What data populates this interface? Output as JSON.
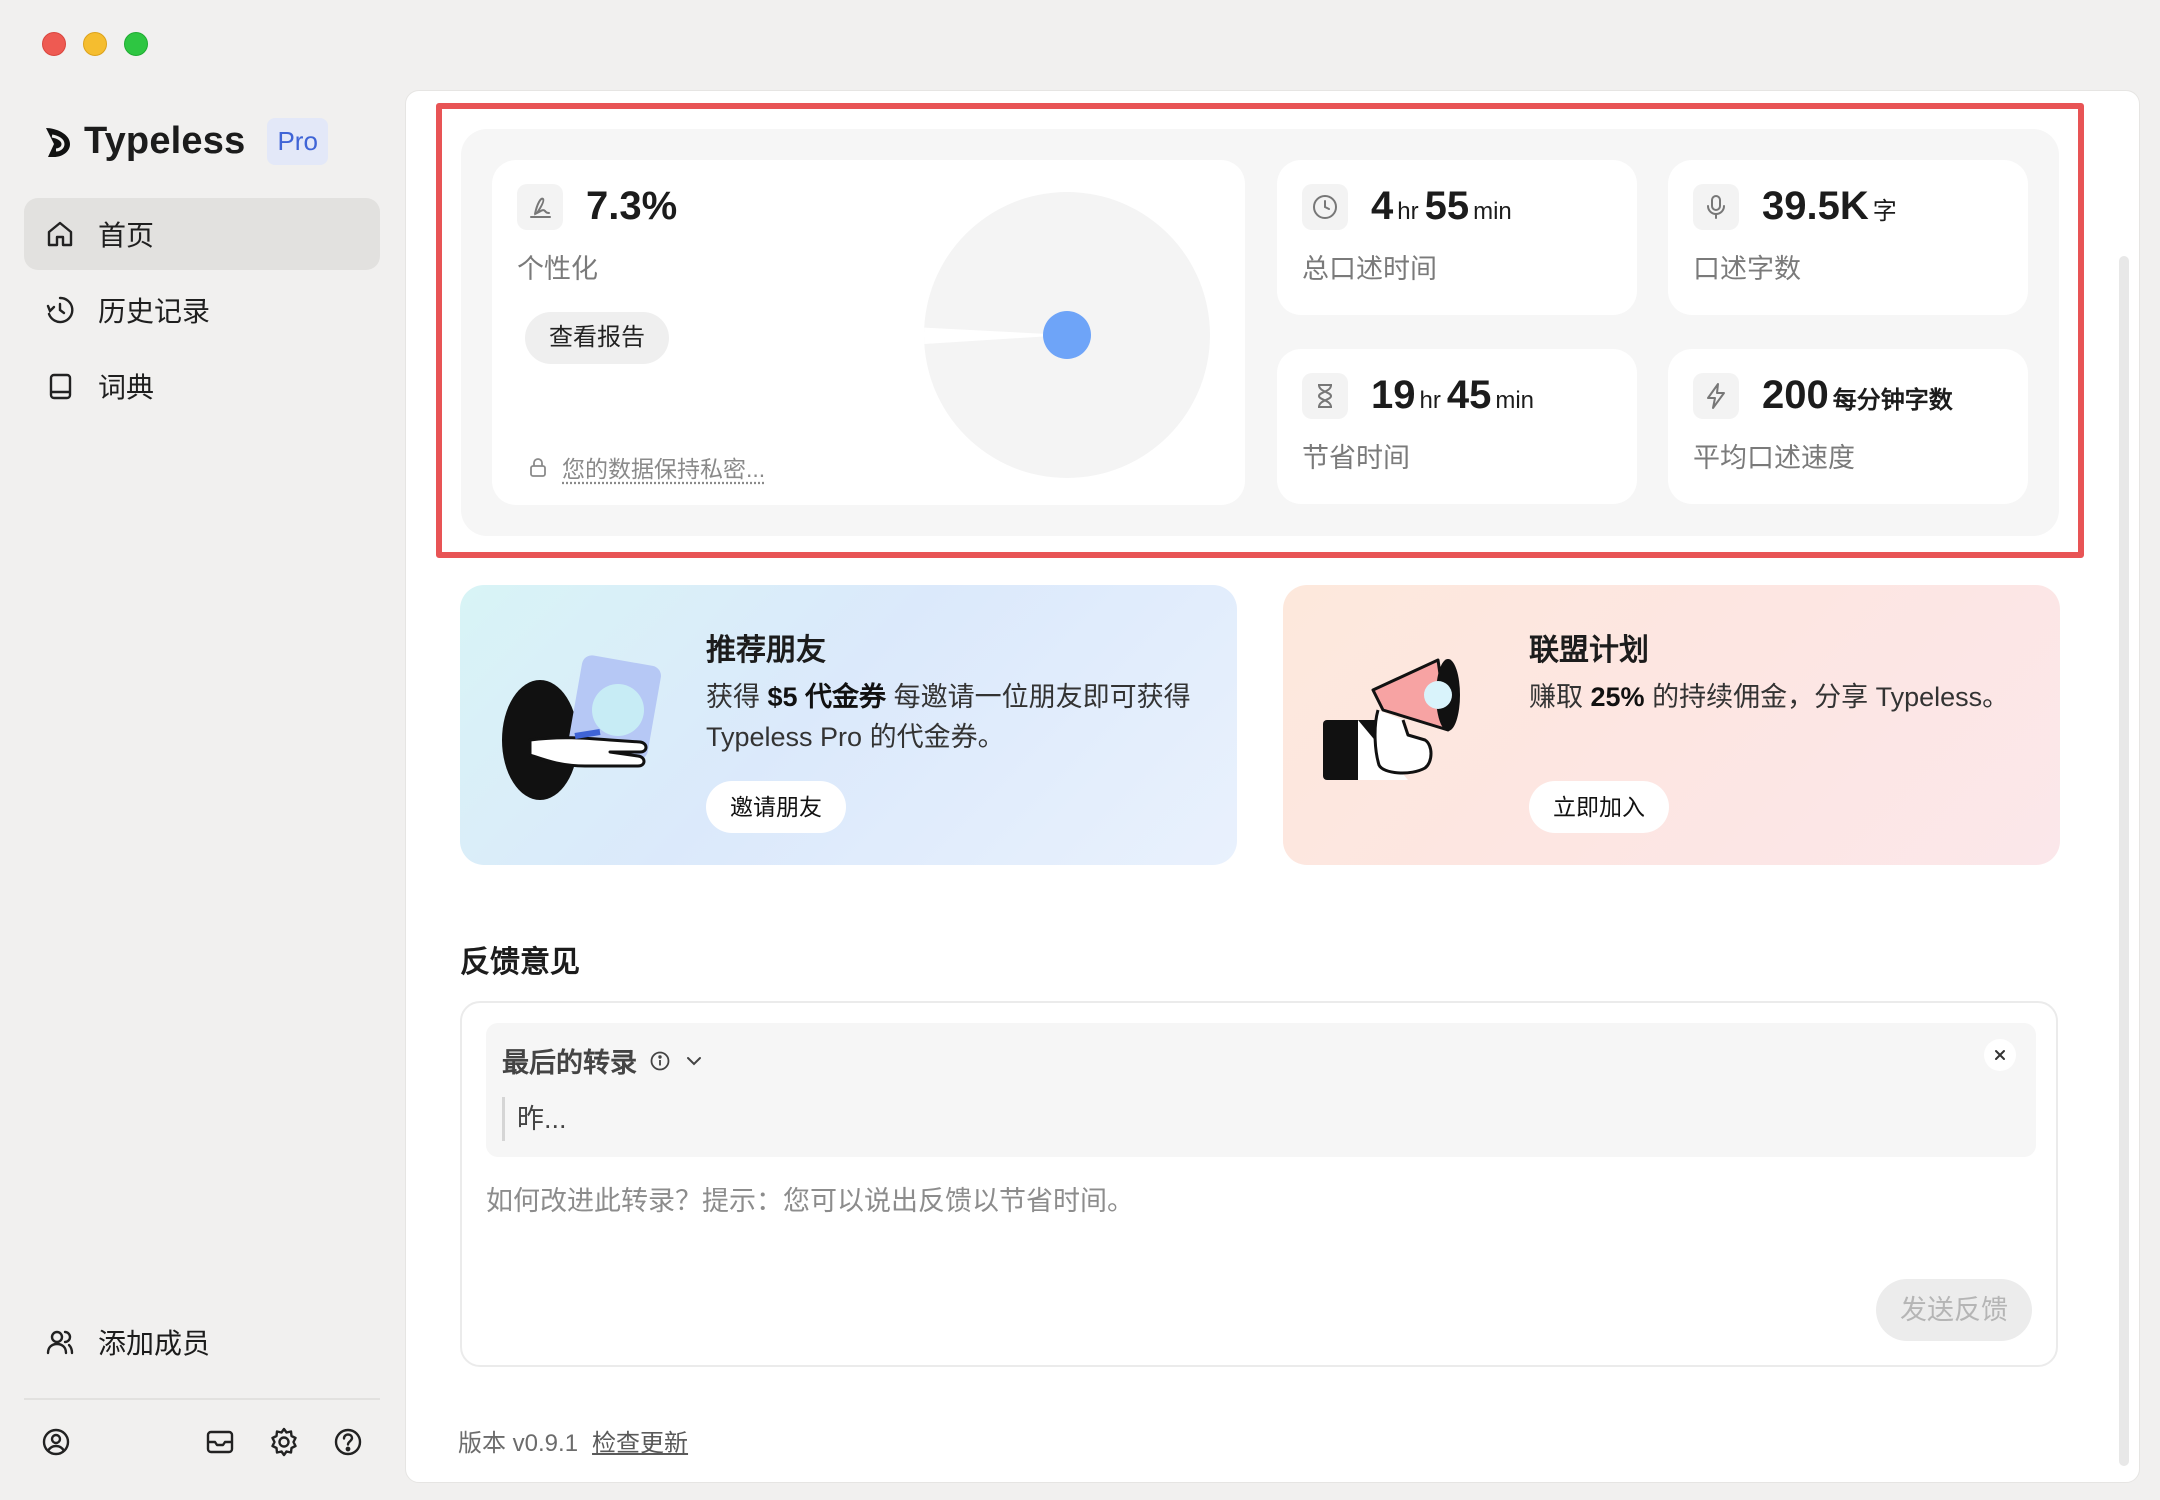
{
  "brand": {
    "name": "Typeless",
    "badge": "Pro"
  },
  "nav": [
    {
      "label": "首页",
      "icon": "home-icon",
      "active": true
    },
    {
      "label": "历史记录",
      "icon": "history-icon"
    },
    {
      "label": "词典",
      "icon": "book-icon"
    }
  ],
  "sidebar_bottom": {
    "add_member": "添加成员"
  },
  "stats": {
    "personal": {
      "value": "7.3%",
      "label": "个性化",
      "button": "查看报告",
      "privacy": "您的数据保持私密..."
    },
    "total_time": {
      "hr": "4",
      "hr_unit": "hr",
      "min": "55",
      "min_unit": "min",
      "label": "总口述时间"
    },
    "word_count": {
      "value": "39.5K",
      "unit": "字",
      "label": "口述字数"
    },
    "saved_time": {
      "hr": "19",
      "hr_unit": "hr",
      "min": "45",
      "min_unit": "min",
      "label": "节省时间"
    },
    "speed": {
      "value": "200",
      "unit": "每分钟字数",
      "label": "平均口述速度"
    }
  },
  "personal_fraction": 0.073,
  "promos": {
    "refer": {
      "title": "推荐朋友",
      "desc_prefix": "获得 ",
      "desc_bold": "$5 代金券",
      "desc_suffix": " 每邀请一位朋友即可获得 Typeless Pro 的代金券。",
      "button": "邀请朋友"
    },
    "affiliate": {
      "title": "联盟计划",
      "desc_prefix": "赚取 ",
      "desc_bold": "25%",
      "desc_suffix": " 的持续佣金，分享 Typeless。",
      "button": "立即加入"
    }
  },
  "feedback": {
    "title": "反馈意见",
    "last_transcript": "最后的转录",
    "quote": "昨...",
    "hint": "如何改进此转录？提示：您可以说出反馈以节省时间。",
    "send": "发送反馈"
  },
  "footer": {
    "version": "版本 v0.9.1",
    "check_update": "检查更新"
  },
  "colors": {
    "highlight": "#e85455",
    "accent": "#3f64d6",
    "pie_dot": "#6ea4f8"
  }
}
